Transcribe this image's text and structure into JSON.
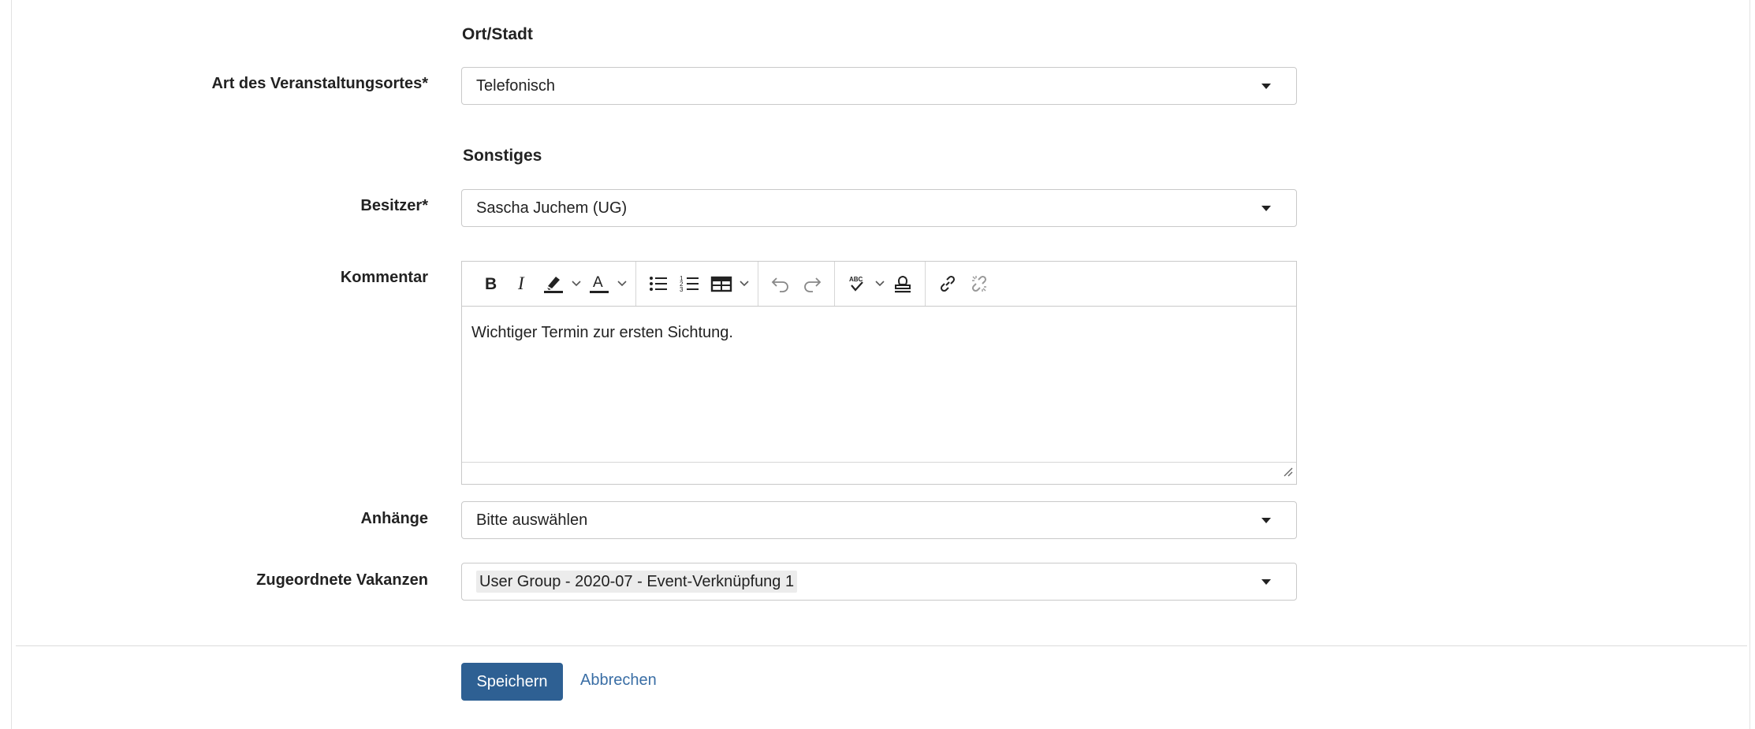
{
  "sections": {
    "location_title": "Ort/Stadt",
    "other_title": "Sonstiges"
  },
  "venue_type": {
    "label": "Art des Veranstaltungsortes*",
    "value": "Telefonisch"
  },
  "owner": {
    "label": "Besitzer*",
    "value": "Sascha Juchem (UG)"
  },
  "comment": {
    "label": "Kommentar",
    "text": "Wichtiger Termin zur ersten Sichtung.",
    "toolbar_icons": [
      "bold-icon",
      "italic-icon",
      "highlight-icon",
      "font-color-icon",
      "bulleted-list-icon",
      "numbered-list-icon",
      "table-icon",
      "undo-icon",
      "redo-icon",
      "spellcheck-icon",
      "stamp-icon",
      "link-icon",
      "unlink-icon"
    ]
  },
  "attachments": {
    "label": "Anhänge",
    "placeholder": "Bitte auswählen"
  },
  "vacancies": {
    "label": "Zugeordnete Vakanzen",
    "selected": "User Group - 2020-07 - Event-Verknüpfung 1"
  },
  "actions": {
    "save_label": "Speichern",
    "cancel_label": "Abbrechen"
  },
  "colors": {
    "primary": "#2e6093",
    "link": "#3a6ea5",
    "border": "#c9c9c9"
  }
}
